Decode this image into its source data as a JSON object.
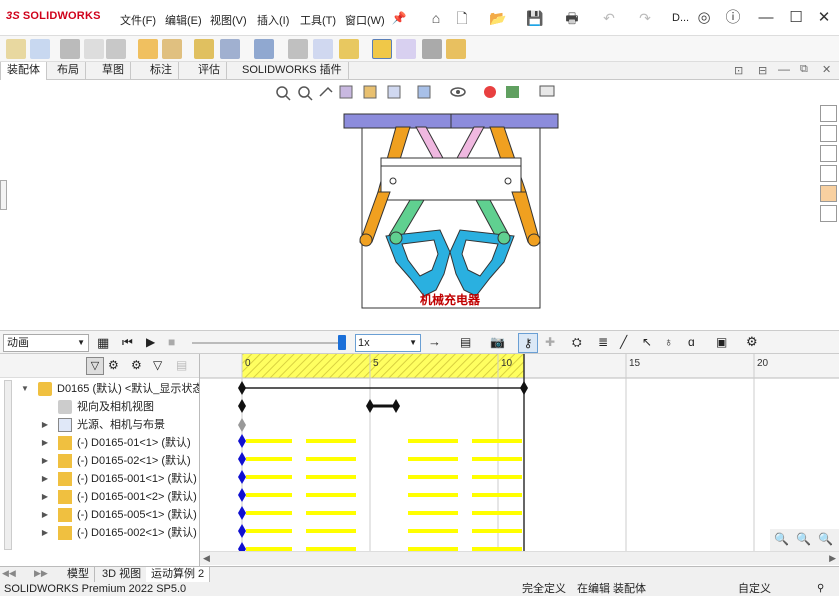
{
  "app": {
    "brand_mark": "3S",
    "brand": "SOLIDWORKS",
    "doc_name": "D..."
  },
  "menu": [
    "文件(F)",
    "编辑(E)",
    "视图(V)",
    "插入(I)",
    "工具(T)",
    "窗口(W)"
  ],
  "command_tabs": [
    "装配体",
    "布局",
    "草图",
    "标注",
    "评估",
    "SOLIDWORKS 插件"
  ],
  "motion": {
    "study_type": "动画",
    "speed": "1x",
    "ruler_labels": [
      "0",
      "5",
      "10",
      "15",
      "20"
    ],
    "ruler_icon": "keyframe-icon"
  },
  "tree": {
    "root": "D0165 (默认) <默认_显示状态",
    "items": [
      {
        "label": "视向及相机视图",
        "icon": "camera-icon"
      },
      {
        "label": "光源、相机与布景",
        "icon": "folder-icon"
      },
      {
        "label": "(-) D0165-01<1> (默认)",
        "icon": "part-icon"
      },
      {
        "label": "(-) D0165-02<1> (默认)",
        "icon": "part-icon"
      },
      {
        "label": "(-) D0165-001<1> (默认)",
        "icon": "part-icon"
      },
      {
        "label": "(-) D0165-001<2> (默认)",
        "icon": "part-icon"
      },
      {
        "label": "(-) D0165-005<1> (默认)",
        "icon": "part-icon"
      },
      {
        "label": "(-) D0165-002<1> (默认)",
        "icon": "part-icon"
      }
    ]
  },
  "model_caption": "机械充电器",
  "sheet_tabs": [
    "模型",
    "3D 视图",
    "运动算例 2"
  ],
  "status": {
    "version": "SOLIDWORKS Premium 2022 SP5.0",
    "definition": "完全定义",
    "editing": "在编辑 装配体",
    "units": "自定义"
  },
  "colors": {
    "accent_red": "#d0021b",
    "timebar_yellow": "#ffff00",
    "key_blue": "#1010d0",
    "gear_cyan": "#2ab0e0",
    "plate_purple": "#8c8cdc",
    "arm_orange": "#f0a020",
    "arm_green": "#60d090",
    "arm_pink": "#f0b8e0",
    "caption_red": "#c00000"
  }
}
